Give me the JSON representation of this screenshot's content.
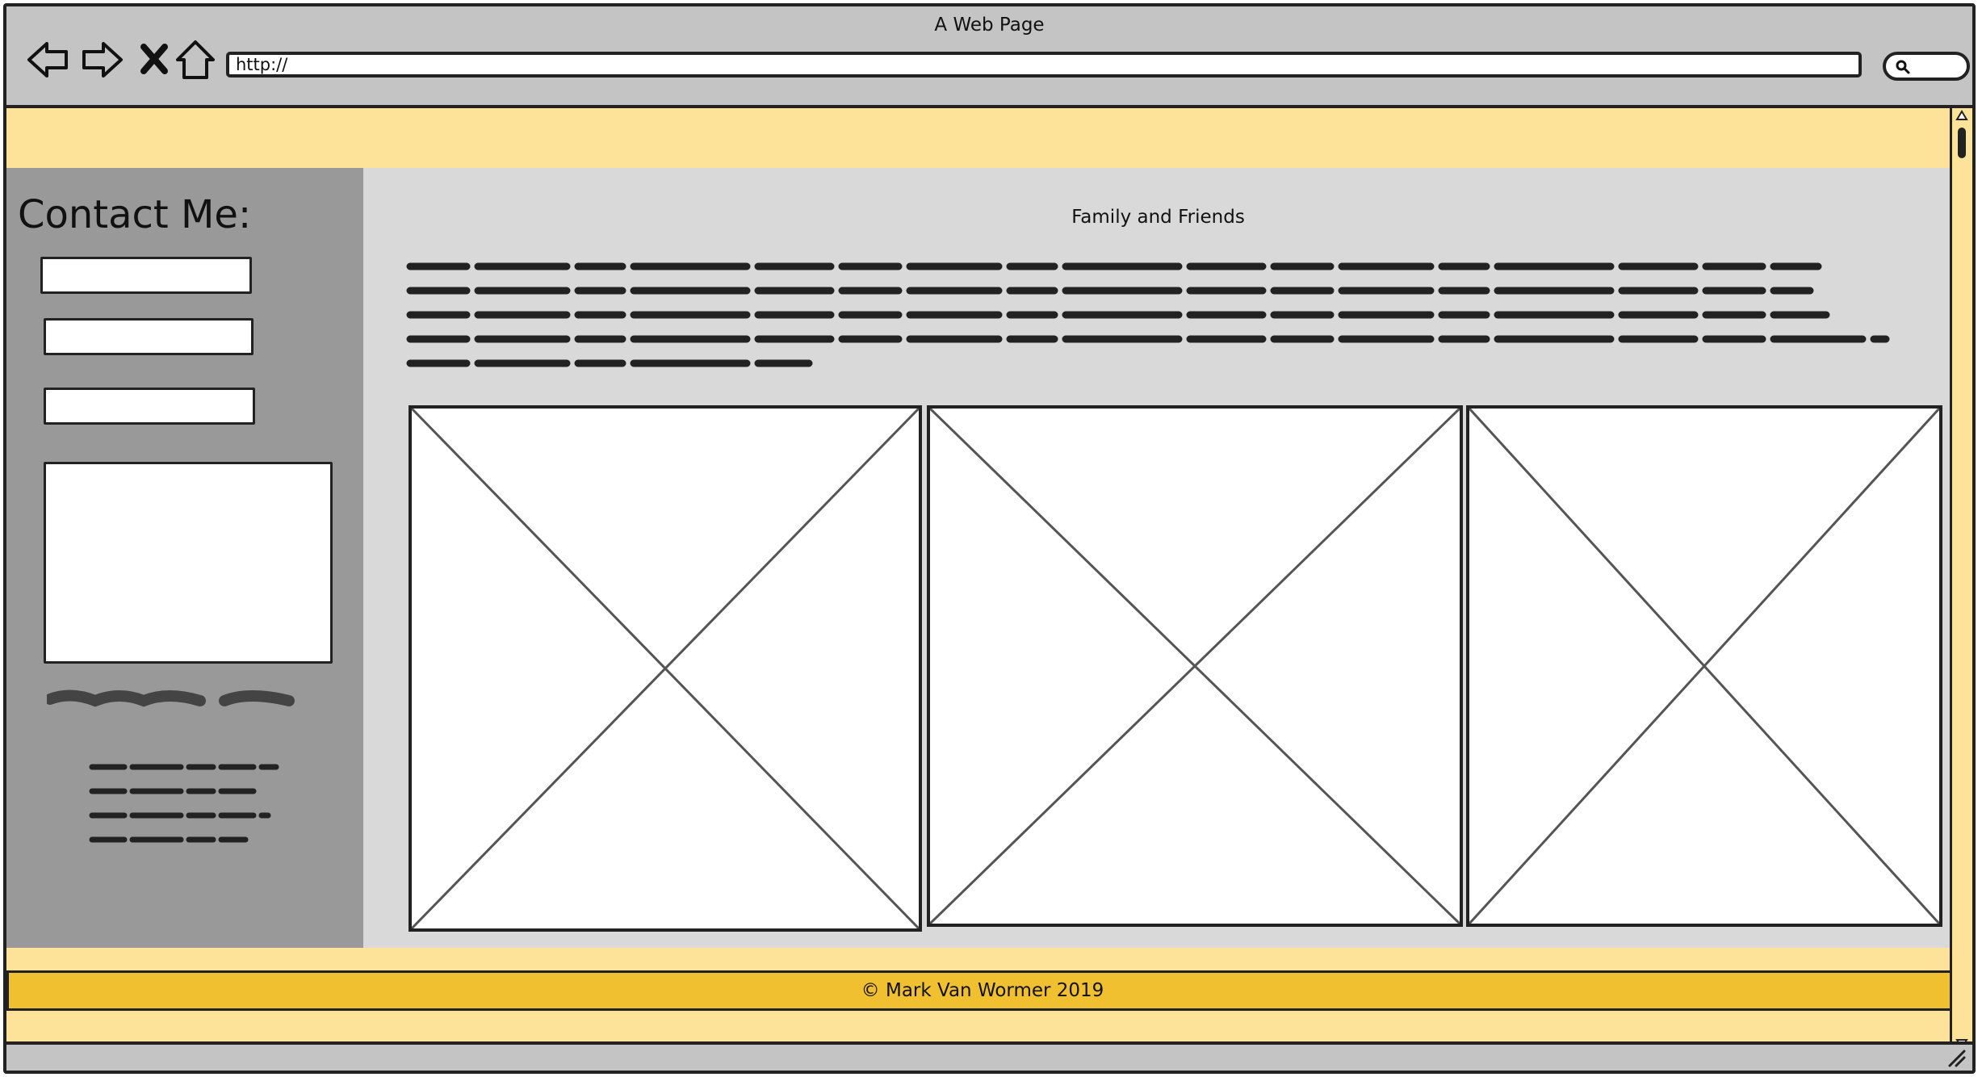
{
  "window": {
    "title": "A Web Page",
    "url": "http://"
  },
  "toolbar": {
    "back_icon": "arrow-left-icon",
    "forward_icon": "arrow-right-icon",
    "stop_icon": "close-icon",
    "home_icon": "home-icon",
    "search_icon": "search-icon"
  },
  "sidebar": {
    "title": "Contact Me:",
    "fields": [
      "text-field",
      "text-field",
      "text-field",
      "textarea"
    ]
  },
  "main": {
    "heading": "Family and Friends",
    "images": [
      "image-placeholder",
      "image-placeholder",
      "image-placeholder"
    ]
  },
  "footer": {
    "text": "© Mark Van Wormer 2019"
  },
  "colors": {
    "banner": "#fde39a",
    "sidebar": "#999999",
    "main": "#d9d9d9",
    "footer": "#f0c030",
    "chrome": "#c4c4c4"
  }
}
